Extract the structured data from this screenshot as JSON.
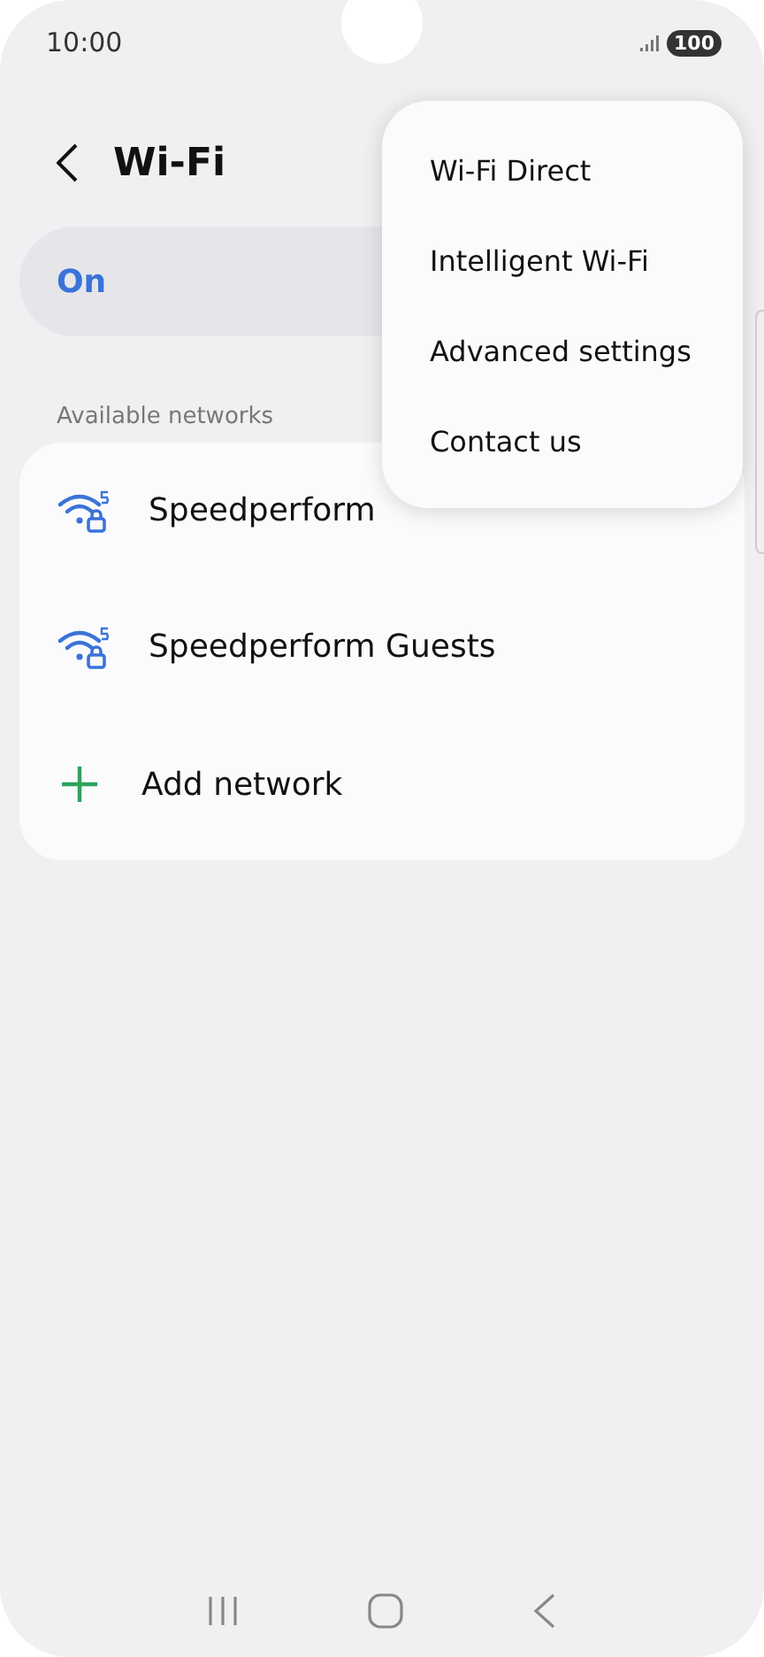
{
  "status_bar": {
    "time": "10:00",
    "battery": "100"
  },
  "header": {
    "title": "Wi-Fi"
  },
  "master_switch": {
    "label": "On"
  },
  "section_label": "Available networks",
  "networks": [
    {
      "name": "Speedperform",
      "kind": "secured"
    },
    {
      "name": "Speedperform Guests",
      "kind": "secured"
    },
    {
      "name": "Add network",
      "kind": "add"
    }
  ],
  "menu": [
    "Wi-Fi Direct",
    "Intelligent Wi-Fi",
    "Advanced settings",
    "Contact us"
  ]
}
